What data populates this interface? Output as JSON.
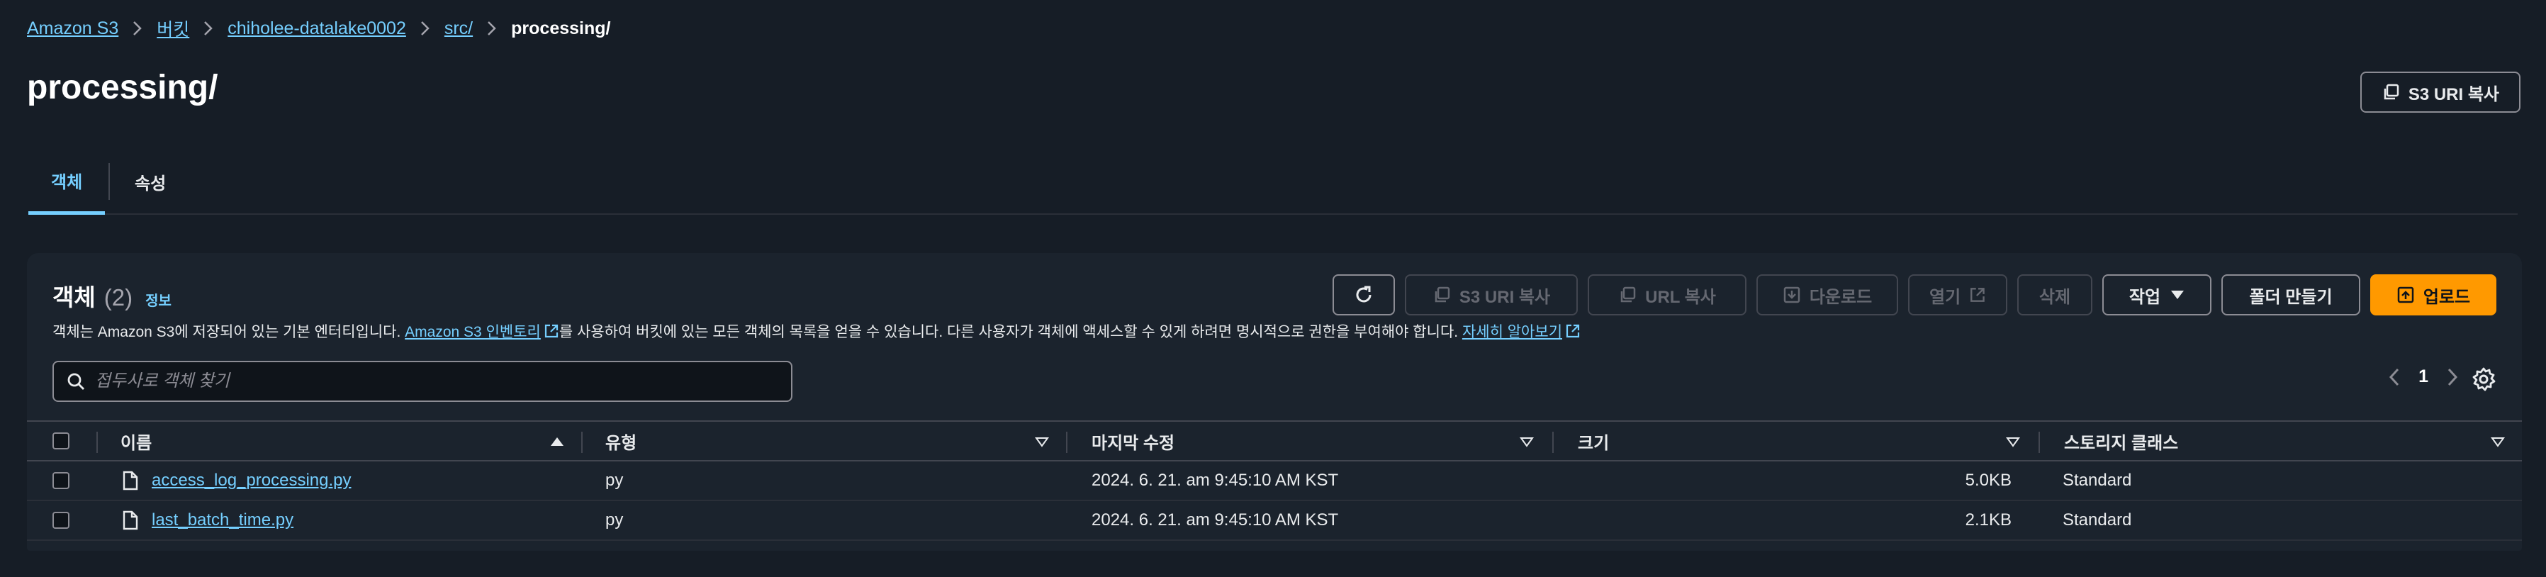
{
  "breadcrumb": {
    "items": [
      "Amazon S3",
      "버킷",
      "chiholee-datalake0002",
      "src/"
    ],
    "current": "processing/"
  },
  "page_title": "processing/",
  "copy_uri_button": "S3 URI 복사",
  "tabs": [
    "객체",
    "속성"
  ],
  "panel": {
    "title": "객체",
    "count": "(2)",
    "info": "정보",
    "desc_before": "객체는 Amazon S3에 저장되어 있는 기본 엔터티입니다. ",
    "desc_link1": "Amazon S3 인벤토리",
    "desc_middle": "를 사용하여 버킷에 있는 모든 객체의 목록을 얻을 수 있습니다. 다른 사용자가 객체에 액세스할 수 있게 하려면 명시적으로 권한을 부여해야 합니다. ",
    "desc_link2": "자세히 알아보기"
  },
  "toolbar": {
    "copy_s3_uri": "S3 URI 복사",
    "copy_url": "URL 복사",
    "download": "다운로드",
    "open": "열기",
    "delete": "삭제",
    "actions": "작업",
    "create_folder": "폴더 만들기",
    "upload": "업로드"
  },
  "search": {
    "placeholder": "접두사로 객체 찾기"
  },
  "pagination": {
    "page": "1"
  },
  "table": {
    "headers": [
      "이름",
      "유형",
      "마지막 수정",
      "크기",
      "스토리지 클래스"
    ],
    "rows": [
      {
        "name": "access_log_processing.py",
        "type": "py",
        "modified": "2024. 6. 21. am 9:45:10 AM KST",
        "size": "5.0KB",
        "storage": "Standard"
      },
      {
        "name": "last_batch_time.py",
        "type": "py",
        "modified": "2024. 6. 21. am 9:45:10 AM KST",
        "size": "2.1KB",
        "storage": "Standard"
      }
    ]
  },
  "colors": {
    "accent": "#75cfff",
    "primary": "#ff9900",
    "background": "#161d26",
    "panel": "#1b232d"
  }
}
